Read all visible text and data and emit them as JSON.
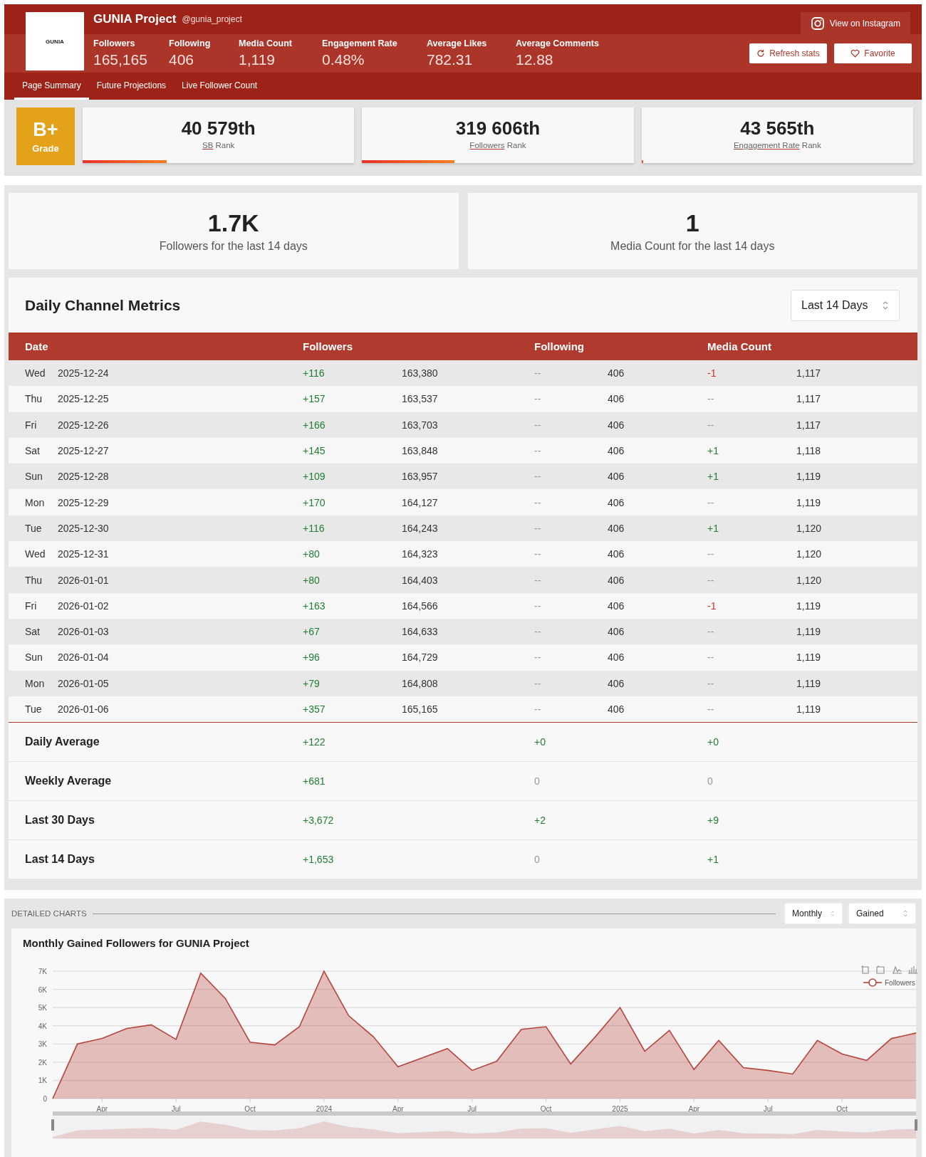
{
  "profile": {
    "logo_text": "GUNIA",
    "name": "GUNIA Project",
    "handle": "@gunia_project",
    "stats": [
      {
        "label": "Followers",
        "value": "165,165"
      },
      {
        "label": "Following",
        "value": "406"
      },
      {
        "label": "Media Count",
        "value": "1,119"
      },
      {
        "label": "Engagement Rate",
        "value": "0.48%"
      },
      {
        "label": "Average Likes",
        "value": "782.31"
      },
      {
        "label": "Average Comments",
        "value": "12.88"
      }
    ],
    "view_button": "View on Instagram",
    "refresh_button": "Refresh stats",
    "favorite_button": "Favorite"
  },
  "tabs": [
    {
      "label": "Page Summary",
      "selected": true
    },
    {
      "label": "Future Projections",
      "selected": false
    },
    {
      "label": "Live Follower Count",
      "selected": false
    }
  ],
  "grade": {
    "value": "B+",
    "label": "Grade"
  },
  "ranks": [
    {
      "value": "40 579th",
      "link": "SB",
      "suffix": "Rank",
      "level": 0.31
    },
    {
      "value": "319 606th",
      "link": "Followers",
      "suffix": "Rank",
      "level": 0.34
    },
    {
      "value": "43 565th",
      "link": "Engagement Rate",
      "suffix": "Rank",
      "level": 0.005
    }
  ],
  "summary_cards": [
    {
      "value": "1.7K",
      "label": "Followers for the last 14 days"
    },
    {
      "value": "1",
      "label": "Media Count for the last 14 days"
    }
  ],
  "metrics": {
    "title": "Daily Channel Metrics",
    "range_select": "Last 14 Days",
    "columns": [
      "Date",
      "Followers",
      "Following",
      "Media Count"
    ],
    "rows": [
      {
        "cells": [
          {
            "day": "Wed",
            "date": "2025-12-24"
          },
          {
            "change": "+116",
            "kind": "gain",
            "total": "163,380"
          },
          {
            "change": "--",
            "kind": "flat",
            "total": "406"
          },
          {
            "change": "-1",
            "kind": "loss",
            "total": "1,117"
          }
        ]
      },
      {
        "cells": [
          {
            "day": "Thu",
            "date": "2025-12-25"
          },
          {
            "change": "+157",
            "kind": "gain",
            "total": "163,537"
          },
          {
            "change": "--",
            "kind": "flat",
            "total": "406"
          },
          {
            "change": "--",
            "kind": "flat",
            "total": "1,117"
          }
        ]
      },
      {
        "cells": [
          {
            "day": "Fri",
            "date": "2025-12-26"
          },
          {
            "change": "+166",
            "kind": "gain",
            "total": "163,703"
          },
          {
            "change": "--",
            "kind": "flat",
            "total": "406"
          },
          {
            "change": "--",
            "kind": "flat",
            "total": "1,117"
          }
        ]
      },
      {
        "cells": [
          {
            "day": "Sat",
            "date": "2025-12-27"
          },
          {
            "change": "+145",
            "kind": "gain",
            "total": "163,848"
          },
          {
            "change": "--",
            "kind": "flat",
            "total": "406"
          },
          {
            "change": "+1",
            "kind": "gain",
            "total": "1,118"
          }
        ]
      },
      {
        "cells": [
          {
            "day": "Sun",
            "date": "2025-12-28"
          },
          {
            "change": "+109",
            "kind": "gain",
            "total": "163,957"
          },
          {
            "change": "--",
            "kind": "flat",
            "total": "406"
          },
          {
            "change": "+1",
            "kind": "gain",
            "total": "1,119"
          }
        ]
      },
      {
        "cells": [
          {
            "day": "Mon",
            "date": "2025-12-29"
          },
          {
            "change": "+170",
            "kind": "gain",
            "total": "164,127"
          },
          {
            "change": "--",
            "kind": "flat",
            "total": "406"
          },
          {
            "change": "--",
            "kind": "flat",
            "total": "1,119"
          }
        ]
      },
      {
        "cells": [
          {
            "day": "Tue",
            "date": "2025-12-30"
          },
          {
            "change": "+116",
            "kind": "gain",
            "total": "164,243"
          },
          {
            "change": "--",
            "kind": "flat",
            "total": "406"
          },
          {
            "change": "+1",
            "kind": "gain",
            "total": "1,120"
          }
        ]
      },
      {
        "cells": [
          {
            "day": "Wed",
            "date": "2025-12-31"
          },
          {
            "change": "+80",
            "kind": "gain",
            "total": "164,323"
          },
          {
            "change": "--",
            "kind": "flat",
            "total": "406"
          },
          {
            "change": "--",
            "kind": "flat",
            "total": "1,120"
          }
        ]
      },
      {
        "cells": [
          {
            "day": "Thu",
            "date": "2026-01-01"
          },
          {
            "change": "+80",
            "kind": "gain",
            "total": "164,403"
          },
          {
            "change": "--",
            "kind": "flat",
            "total": "406"
          },
          {
            "change": "--",
            "kind": "flat",
            "total": "1,120"
          }
        ]
      },
      {
        "cells": [
          {
            "day": "Fri",
            "date": "2026-01-02"
          },
          {
            "change": "+163",
            "kind": "gain",
            "total": "164,566"
          },
          {
            "change": "--",
            "kind": "flat",
            "total": "406"
          },
          {
            "change": "-1",
            "kind": "loss",
            "total": "1,119"
          }
        ]
      },
      {
        "cells": [
          {
            "day": "Sat",
            "date": "2026-01-03"
          },
          {
            "change": "+67",
            "kind": "gain",
            "total": "164,633"
          },
          {
            "change": "--",
            "kind": "flat",
            "total": "406"
          },
          {
            "change": "--",
            "kind": "flat",
            "total": "1,119"
          }
        ]
      },
      {
        "cells": [
          {
            "day": "Sun",
            "date": "2026-01-04"
          },
          {
            "change": "+96",
            "kind": "gain",
            "total": "164,729"
          },
          {
            "change": "--",
            "kind": "flat",
            "total": "406"
          },
          {
            "change": "--",
            "kind": "flat",
            "total": "1,119"
          }
        ]
      },
      {
        "cells": [
          {
            "day": "Mon",
            "date": "2026-01-05"
          },
          {
            "change": "+79",
            "kind": "gain",
            "total": "164,808"
          },
          {
            "change": "--",
            "kind": "flat",
            "total": "406"
          },
          {
            "change": "--",
            "kind": "flat",
            "total": "1,119"
          }
        ]
      },
      {
        "cells": [
          {
            "day": "Tue",
            "date": "2026-01-06"
          },
          {
            "change": "+357",
            "kind": "gain",
            "total": "165,165"
          },
          {
            "change": "--",
            "kind": "flat",
            "total": "406"
          },
          {
            "change": "--",
            "kind": "flat",
            "total": "1,119"
          }
        ]
      }
    ],
    "summary": [
      {
        "cells": [
          {
            "label": "Daily Average"
          },
          {
            "change": "+122",
            "kind": "gain"
          },
          {
            "change": "+0",
            "kind": "gain"
          },
          {
            "change": "+0",
            "kind": "gain"
          }
        ]
      },
      {
        "cells": [
          {
            "label": "Weekly Average"
          },
          {
            "change": "+681",
            "kind": "gain"
          },
          {
            "change": "0",
            "kind": "flat"
          },
          {
            "change": "0",
            "kind": "flat"
          }
        ]
      },
      {
        "cells": [
          {
            "label": "Last 30 Days"
          },
          {
            "change": "+3,672",
            "kind": "gain"
          },
          {
            "change": "+2",
            "kind": "gain"
          },
          {
            "change": "+9",
            "kind": "gain"
          }
        ]
      },
      {
        "cells": [
          {
            "label": "Last 14 Days"
          },
          {
            "change": "+1,653",
            "kind": "gain"
          },
          {
            "change": "0",
            "kind": "flat"
          },
          {
            "change": "+1",
            "kind": "gain"
          }
        ]
      }
    ]
  },
  "charts": {
    "section_label": "DETAILED CHARTS",
    "period_select": "Monthly",
    "mode_select": "Gained",
    "chart_data": {
      "type": "area",
      "title": "Monthly Gained Followers for GUNIA Project",
      "grid": true,
      "categories": [
        null,
        null,
        "Apr",
        null,
        null,
        "Jul",
        null,
        null,
        "Oct",
        null,
        null,
        "2024",
        null,
        null,
        "Apr",
        null,
        null,
        "Jul",
        null,
        null,
        "Oct",
        null,
        null,
        "2025",
        null,
        null,
        "Apr",
        null,
        null,
        "Jul",
        null,
        null,
        "Oct",
        null,
        null,
        null
      ],
      "series": [
        {
          "name": "Followers",
          "color": "#b5453d",
          "values": [
            0,
            3000,
            3300,
            3850,
            4050,
            3250,
            6900,
            5500,
            3100,
            2950,
            3950,
            7000,
            4550,
            3400,
            1750,
            2250,
            2750,
            1550,
            2050,
            3800,
            3950,
            1900,
            3400,
            5000,
            2600,
            3750,
            1600,
            3200,
            1700,
            1550,
            1350,
            3200,
            2450,
            2100,
            3300,
            3600
          ]
        }
      ],
      "ylim": [
        0,
        7000
      ],
      "yticks": [
        {
          "value": 0,
          "label": "0"
        },
        {
          "value": 1000,
          "label": "1K"
        },
        {
          "value": 2000,
          "label": "2K"
        },
        {
          "value": 3000,
          "label": "3K"
        },
        {
          "value": 4000,
          "label": "4K"
        },
        {
          "value": 5000,
          "label": "5K"
        },
        {
          "value": 6000,
          "label": "6K"
        },
        {
          "value": 7000,
          "label": "7K"
        }
      ]
    }
  }
}
